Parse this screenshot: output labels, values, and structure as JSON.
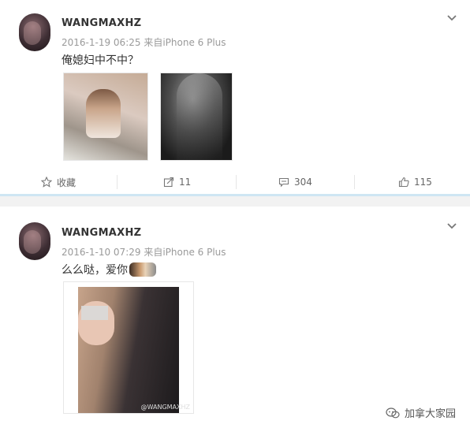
{
  "post1": {
    "username": "WANGMAXHZ",
    "date": "2016-1-19 06:25",
    "source": "来自",
    "device": "iPhone 6 Plus",
    "text": "俺媳妇中不中？",
    "actions": {
      "favorite_label": "收藏",
      "repost_count": "11",
      "comment_count": "304",
      "like_count": "115"
    }
  },
  "post2": {
    "username": "WANGMAXHZ",
    "date": "2016-1-10 07:29",
    "source": "来自",
    "device": "iPhone 6 Plus",
    "text": "么么哒，爱你",
    "watermark": "@WANGMAXHZ"
  },
  "brand": {
    "name": "加拿大家园"
  },
  "colors": {
    "separator_accent": "#cfe6f3",
    "meta_gray": "#9a9a9a"
  },
  "icons": [
    "chevron-down-icon",
    "star-icon",
    "repost-icon",
    "comment-icon",
    "like-icon",
    "brand-logo-icon",
    "emoji-icon"
  ]
}
